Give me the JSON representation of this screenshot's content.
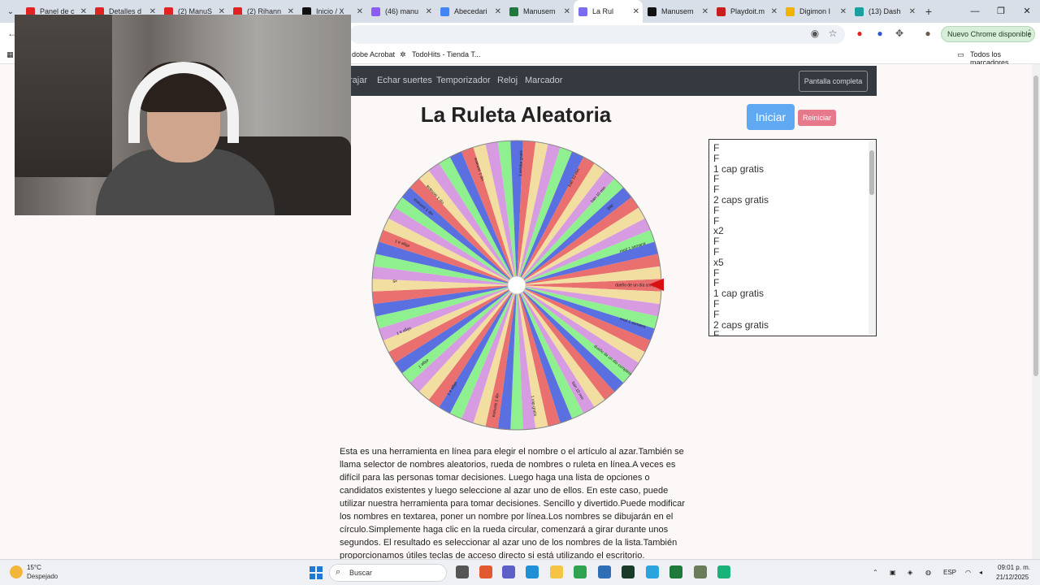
{
  "browser": {
    "tabs": [
      {
        "title": "Panel de c",
        "color": "#e02424"
      },
      {
        "title": "Detalles d",
        "color": "#e02424"
      },
      {
        "title": "(2) ManuS",
        "color": "#e02424"
      },
      {
        "title": "(2) Rihann",
        "color": "#e02424"
      },
      {
        "title": "Inicio / X",
        "color": "#111111"
      },
      {
        "title": "(46) manu",
        "color": "#8b5cf6"
      },
      {
        "title": "Abecedari",
        "color": "#4285f4"
      },
      {
        "title": "Manusem",
        "color": "#1d7a3c"
      },
      {
        "title": "La Rul",
        "color": "#7a6df0",
        "active": true
      },
      {
        "title": "Manusem",
        "color": "#111111"
      },
      {
        "title": "Playdoit.m",
        "color": "#c81e1e"
      },
      {
        "title": "Digimon I",
        "color": "#f0b400"
      },
      {
        "title": "(13) Dash",
        "color": "#1aa0a0"
      }
    ],
    "chrome_update": "Nuevo Chrome disponible",
    "bookmarks": {
      "acrobat": "dobe Acrobat",
      "todohits": "TodoHits - Tienda T...",
      "all": "Todos los marcadores"
    }
  },
  "site": {
    "nav": [
      "rajar",
      "Echar suertes",
      "Temporizador",
      "Reloj",
      "Marcador"
    ],
    "fullscreen": "Pantalla completa",
    "title": "La Ruleta Aleatoria",
    "start": "Iniciar",
    "reset": "Reiniciar",
    "entries": [
      "F",
      "F",
      "1 cap gratis",
      "F",
      "F",
      "2 caps gratis",
      "F",
      "F",
      "x2",
      "F",
      "F",
      "x5",
      "F",
      "F",
      "1 cap gratis",
      "F",
      "F",
      "2 caps gratis",
      "F"
    ],
    "description": "Esta es una herramienta en línea para elegir el nombre o el artículo al azar.También se llama selector de nombres aleatorios, rueda de nombres o ruleta en línea.A veces es difícil para las personas tomar decisiones. Luego haga una lista de opciones o candidatos existentes y luego seleccione al azar uno de ellos. En este caso, puede utilizar nuestra herramienta para tomar decisiones. Sencillo y divertido.Puede modificar los nombres en textarea, poner un nombre por línea.Los nombres se dibujarán en el círculo.Simplemente haga clic en la rueda circular, comenzará a girar durante unos segundos. El resultado es seleccionar al azar uno de los nombres de la lista.También proporcionamos útiles teclas de acceso directo si está utilizando el escritorio."
  },
  "wheel": {
    "segments": 72,
    "colors": [
      "#ea6f6f",
      "#f2dea0",
      "#d79be2",
      "#8ff08f",
      "#5a6fe0"
    ],
    "labels": [
      {
        "text": "dueño de un día completo",
        "angle": 0
      },
      {
        "text": "mod 1 semana",
        "angle": -18
      },
      {
        "text": "gap",
        "angle": -40
      },
      {
        "text": "ban 10 min",
        "angle": -48
      },
      {
        "text": "ban 10 min",
        "angle": -62
      },
      {
        "text": "1 arroba gratis",
        "angle": -88
      },
      {
        "text": "vip 1 semana",
        "angle": -108
      },
      {
        "text": "vip 1 semana",
        "angle": -132
      },
      {
        "text": "vip 1 semana",
        "angle": -140
      },
      {
        "text": "elige a 1",
        "angle": -160
      },
      {
        "text": "x5",
        "angle": -178
      },
      {
        "text": "elige a 1",
        "angle": 158
      },
      {
        "text": "elige 1",
        "angle": 140
      },
      {
        "text": "elige a 1",
        "angle": 122
      },
      {
        "text": "vip 1 semana",
        "angle": 100
      },
      {
        "text": "1 cap gratis",
        "angle": 82
      },
      {
        "text": "ban 10 min",
        "angle": 60
      },
      {
        "text": "dueño de un día completo",
        "angle": 38
      },
      {
        "text": "mod 1 semana",
        "angle": 18
      }
    ]
  },
  "taskbar": {
    "temp": "15°C",
    "weather": "Despejado",
    "search": "Buscar",
    "lang": "ESP",
    "time": "09:01 p. m.",
    "date": "21/12/2025"
  }
}
